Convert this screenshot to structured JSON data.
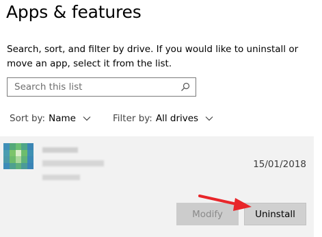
{
  "header": {
    "title": "Apps & features"
  },
  "description": "Search, sort, and filter by drive. If you would like to uninstall or move an app, select it from the list.",
  "search": {
    "placeholder": "Search this list"
  },
  "sort": {
    "label": "Sort by:",
    "value": "Name"
  },
  "filter": {
    "label": "Filter by:",
    "value": "All drives"
  },
  "app": {
    "date": "15/01/2018"
  },
  "buttons": {
    "modify": "Modify",
    "uninstall": "Uninstall"
  },
  "colors": {
    "annotation_arrow": "#e8262a",
    "selected_row_bg": "#f2f2f2"
  }
}
